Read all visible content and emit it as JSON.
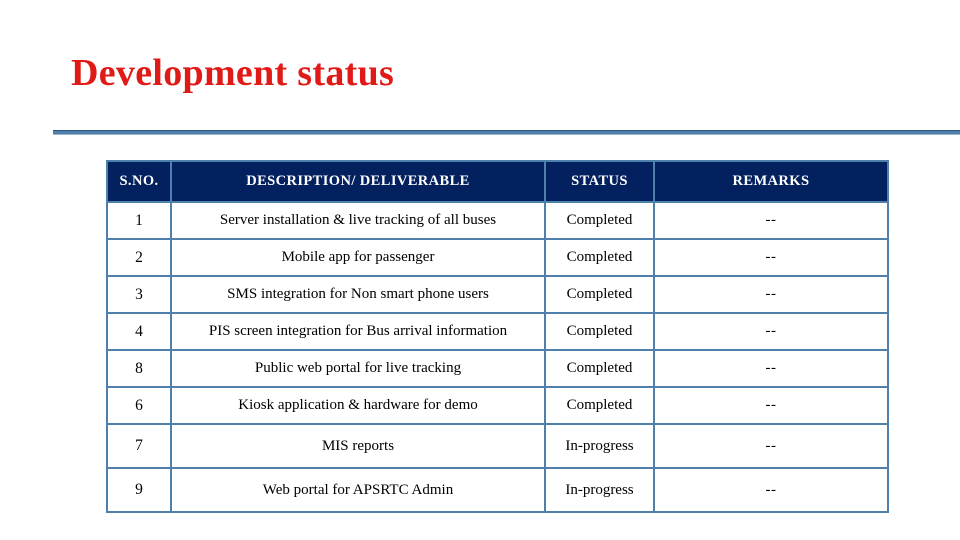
{
  "slide": {
    "title": "Development status",
    "accent_red": "#e01b17",
    "divider_color": "#4f7fab",
    "header_bg": "#04215f",
    "header_text_color": "#ffffff",
    "border_color": "#4f7fab",
    "background": "#ffffff"
  },
  "table": {
    "headers": {
      "sno": "S.NO.",
      "description": "DESCRIPTION/ DELIVERABLE",
      "status": "STATUS",
      "remarks": "REMARKS"
    },
    "rows": [
      {
        "sno": "1",
        "description": "Server installation & live tracking of all buses",
        "status": "Completed",
        "remarks": "--"
      },
      {
        "sno": "2",
        "description": "Mobile app for passenger",
        "status": "Completed",
        "remarks": "--"
      },
      {
        "sno": "3",
        "description": "SMS integration for Non smart phone users",
        "status": "Completed",
        "remarks": "--"
      },
      {
        "sno": "4",
        "description": "PIS screen integration for Bus arrival information",
        "status": "Completed",
        "remarks": "--"
      },
      {
        "sno": "8",
        "description": "Public web portal for live tracking",
        "status": "Completed",
        "remarks": "--"
      },
      {
        "sno": "6",
        "description": "Kiosk application & hardware for demo",
        "status": "Completed",
        "remarks": "--"
      },
      {
        "sno": "7",
        "description": "MIS reports",
        "status": "In-progress",
        "remarks": "--"
      },
      {
        "sno": "9",
        "description": "Web portal for APSRTC Admin",
        "status": "In-progress",
        "remarks": "--"
      }
    ]
  }
}
